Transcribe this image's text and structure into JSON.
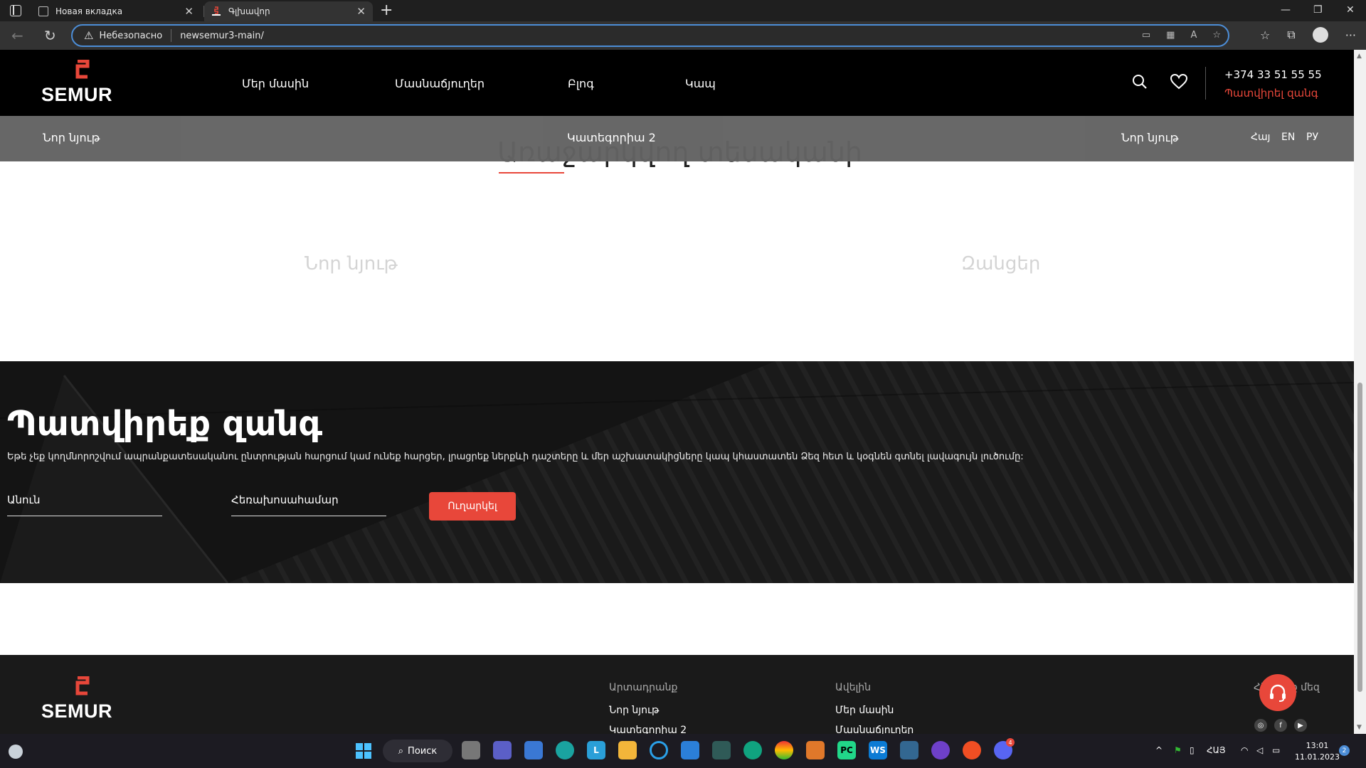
{
  "browser": {
    "tabs": [
      {
        "title": "Новая вкладка"
      },
      {
        "title": "Գլխավոր"
      }
    ],
    "insecure_label": "Небезопасно",
    "url": "newsemur3-main/"
  },
  "site": {
    "logo_text": "SEMUR",
    "menu": [
      "Մեր մասին",
      "Մասնաճյուղեր",
      "Բլոգ",
      "Կապ"
    ],
    "phone": "+374 33 51 55 55",
    "callback_link": "Պատվիրել զանգ",
    "subnav": {
      "left": "Նոր նյութ",
      "center": "Կատեգորիա 2",
      "right": "Նոր նյութ"
    },
    "languages": [
      "Հայ",
      "EN",
      "РУ"
    ],
    "section_title": "Առաջարկվող տեսականի",
    "ghost_tabs": [
      "Նոր նյութ",
      "Զանցեր"
    ],
    "callback": {
      "title": "Պատվիրեք զանգ",
      "description": "Եթե չեք կողմնորոշվում ապրանքատեսականու ընտրության հարցում կամ ունեք հարցեր, լրացրեք ներքևի դաշտերը և մեր աշխատակիցները կապ կհաստատեն Ձեզ հետ և կօգնեն գտնել լավագույն լուծումը:",
      "name_placeholder": "Անուն",
      "phone_placeholder": "Հեռախոսահամար",
      "submit": "Ուղարկել"
    },
    "footer": {
      "col1_title": "Արտադրանք",
      "col1_links": [
        "Նոր նյութ",
        "Կատեգորիա 2"
      ],
      "col2_title": "Ավելին",
      "col2_links": [
        "Մեր մասին",
        "Մասնաճյուղեր"
      ],
      "col3_title": "Հետևեք մեզ"
    },
    "colors": {
      "accent": "#e8473a",
      "header_bg": "#000000"
    }
  },
  "taskbar": {
    "search": "Поиск",
    "lang": "ՀԱՅ",
    "time": "13:01",
    "date": "11.01.2023",
    "notifications": "2",
    "discord_badge": "4"
  }
}
